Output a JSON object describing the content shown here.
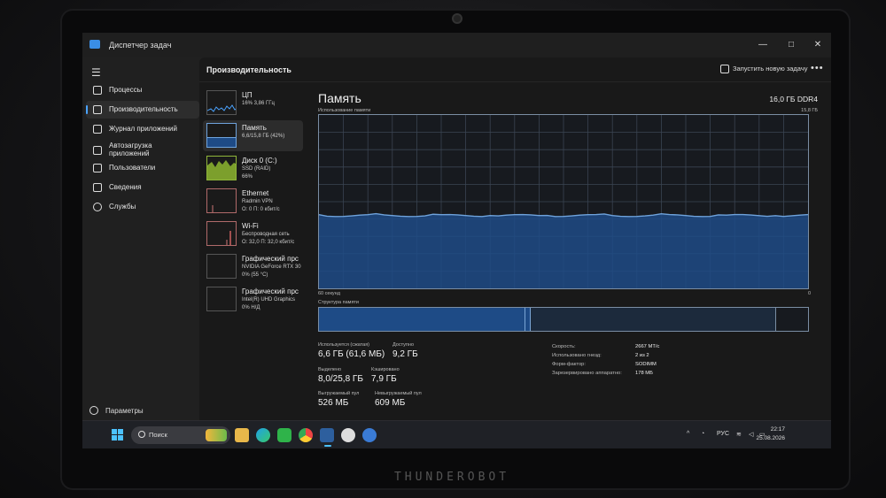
{
  "window": {
    "title": "Диспетчер задач",
    "controls": {
      "minimize": "—",
      "maximize": "□",
      "close": "✕"
    }
  },
  "nav": {
    "menu_icon": "hamburger-icon",
    "items": [
      {
        "label": "Процессы",
        "icon": "processes-icon"
      },
      {
        "label": "Производительность",
        "icon": "performance-icon",
        "active": true
      },
      {
        "label": "Журнал приложений",
        "icon": "app-history-icon"
      },
      {
        "label": "Автозагрузка приложений",
        "icon": "startup-icon"
      },
      {
        "label": "Пользователи",
        "icon": "users-icon"
      },
      {
        "label": "Сведения",
        "icon": "details-icon"
      },
      {
        "label": "Службы",
        "icon": "services-icon"
      }
    ],
    "settings": "Параметры"
  },
  "header": {
    "title": "Производительность",
    "run_task": "Запустить новую задачу",
    "more": "•••"
  },
  "tiles": [
    {
      "name": "ЦП",
      "sub": "16% 3,86 ГГц",
      "sub2": ""
    },
    {
      "name": "Память",
      "sub": "6,6/15,8 ГБ (42%)",
      "sub2": ""
    },
    {
      "name": "Диск 0 (C:)",
      "sub": "SSD (RAID)",
      "sub2": "66%"
    },
    {
      "name": "Ethernet",
      "sub": "Radmin VPN",
      "sub2": "О: 0 П: 0 кбит/с"
    },
    {
      "name": "Wi-Fi",
      "sub": "Беспроводная сеть",
      "sub2": "О: 32,0 П: 32,0 кбит/с"
    },
    {
      "name": "Графический прс",
      "sub": "NVIDIA GeForce RTX 30",
      "sub2": "0% (55 °C)"
    },
    {
      "name": "Графический прс",
      "sub": "Intel(R) UHD Graphics",
      "sub2": "0% Н/Д"
    }
  ],
  "memory": {
    "title": "Память",
    "total": "16,0 ГБ DDR4",
    "graph_label": "Использование памяти",
    "graph_max": "15,8 ГБ",
    "axis_left": "60 секунд",
    "axis_right": "0",
    "usage_fraction": 0.42,
    "structure_label": "Структура памяти",
    "stats": {
      "in_use_label": "Используется (сжатая)",
      "in_use": "6,6 ГБ (61,6 МБ)",
      "available_label": "Доступно",
      "available": "9,2 ГБ",
      "committed_label": "Выделено",
      "committed": "8,0/25,8 ГБ",
      "cached_label": "Кэшировано",
      "cached": "7,9 ГБ",
      "paged_label": "Выгружаемый пул",
      "paged": "526 МБ",
      "nonpaged_label": "Невыгружаемый пул",
      "nonpaged": "609 МБ"
    },
    "specs": {
      "speed_label": "Скорость:",
      "speed": "2667 MT/c",
      "slots_label": "Использовано гнезд:",
      "slots": "2 из 2",
      "form_label": "Форм-фактор:",
      "form": "SODIMM",
      "reserved_label": "Зарезервировано аппаратно:",
      "reserved": "178 МБ"
    }
  },
  "taskbar": {
    "search_placeholder": "Поиск",
    "lang": "РУС",
    "time": "22:17",
    "date": "25.08.2026"
  },
  "colors": {
    "accent": "#4aa3ff",
    "graph_fill": "#1e4b86",
    "graph_line": "#6fa3dc"
  },
  "bezel": {
    "brand": "THUNDEROBOT"
  }
}
